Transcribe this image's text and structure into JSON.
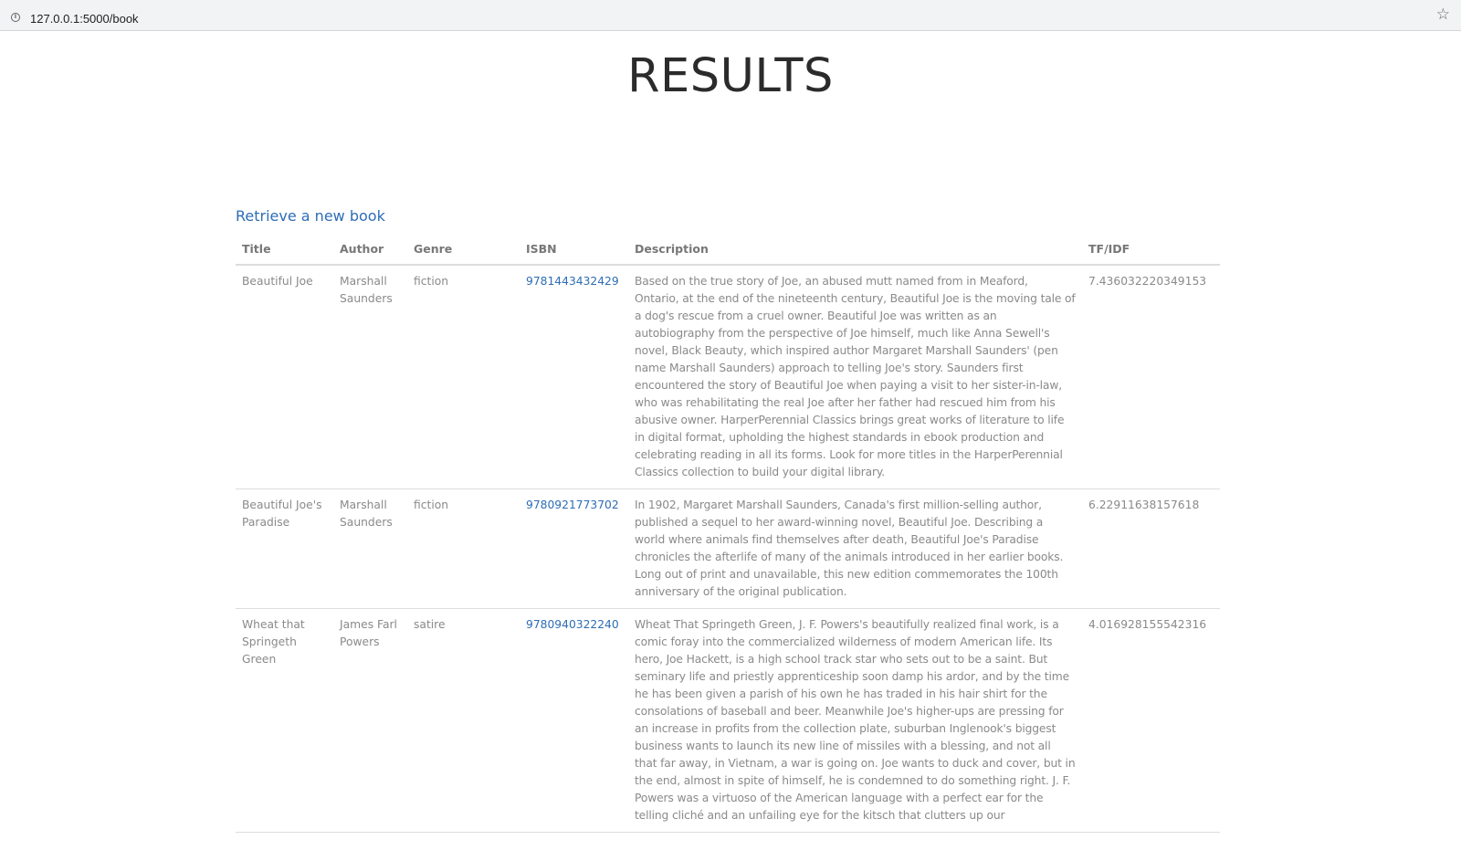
{
  "browser": {
    "url": "127.0.0.1:5000/book",
    "info_icon": "info-icon",
    "bookmark_icon": "star-icon"
  },
  "page": {
    "title": "RESULTS",
    "new_book_link": "Retrieve a new book"
  },
  "colors": {
    "link": "#2e6db4",
    "text": "#8a8a8a",
    "heading": "#2b2b2b"
  },
  "table": {
    "headers": {
      "title": "Title",
      "author": "Author",
      "genre": "Genre",
      "isbn": "ISBN",
      "description": "Description",
      "tfidf": "TF/IDF"
    },
    "rows": [
      {
        "title": "Beautiful Joe",
        "author": "Marshall Saunders",
        "genre": "fiction",
        "isbn": "9781443432429",
        "description": "Based on the true story of Joe, an abused mutt named from in Meaford, Ontario, at the end of the nineteenth century, Beautiful Joe is the moving tale of a dog's rescue from a cruel owner. Beautiful Joe was written as an autobiography from the perspective of Joe himself, much like Anna Sewell's novel, Black Beauty, which inspired author Margaret Marshall Saunders' (pen name Marshall Saunders) approach to telling Joe's story. Saunders first encountered the story of Beautiful Joe when paying a visit to her sister-in-law, who was rehabilitating the real Joe after her father had rescued him from his abusive owner. HarperPerennial Classics brings great works of literature to life in digital format, upholding the highest standards in ebook production and celebrating reading in all its forms. Look for more titles in the HarperPerennial Classics collection to build your digital library.",
        "tfidf": "7.436032220349153"
      },
      {
        "title": "Beautiful Joe's Paradise",
        "author": "Marshall Saunders",
        "genre": "fiction",
        "isbn": "9780921773702",
        "description": "In 1902, Margaret Marshall Saunders, Canada's first million-selling author, published a sequel to her award-winning novel, Beautiful Joe. Describing a world where animals find themselves after death, Beautiful Joe's Paradise chronicles the afterlife of many of the animals introduced in her earlier books. Long out of print and unavailable, this new edition commemorates the 100th anniversary of the original publication.",
        "tfidf": "6.22911638157618"
      },
      {
        "title": "Wheat that Springeth Green",
        "author": "James Farl Powers",
        "genre": "satire",
        "isbn": "9780940322240",
        "description": "Wheat That Springeth Green, J. F. Powers's beautifully realized final work, is a comic foray into the commercialized wilderness of modern American life. Its hero, Joe Hackett, is a high school track star who sets out to be a saint. But seminary life and priestly apprenticeship soon damp his ardor, and by the time he has been given a parish of his own he has traded in his hair shirt for the consolations of baseball and beer. Meanwhile Joe's higher-ups are pressing for an increase in profits from the collection plate, suburban Inglenook's biggest business wants to launch its new line of missiles with a blessing, and not all that far away, in Vietnam, a war is going on. Joe wants to duck and cover, but in the end, almost in spite of himself, he is condemned to do something right. J. F. Powers was a virtuoso of the American language with a perfect ear for the telling cliché and an unfailing eye for the kitsch that clutters up our",
        "tfidf": "4.016928155542316"
      }
    ]
  }
}
